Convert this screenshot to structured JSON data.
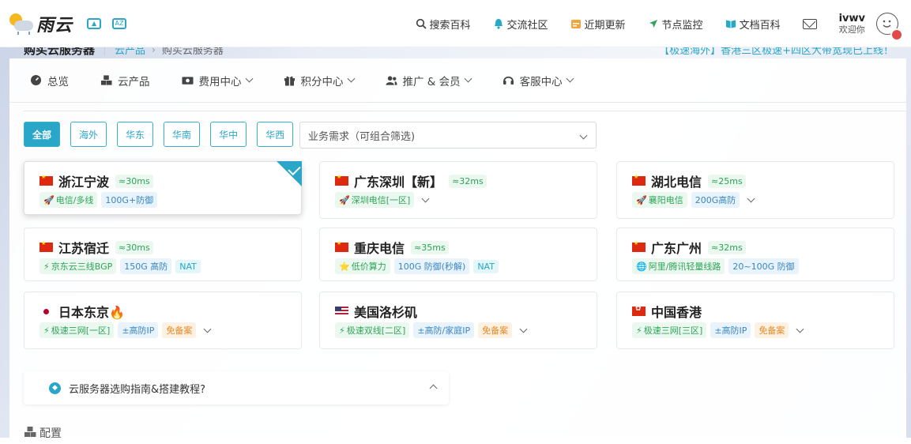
{
  "header": {
    "logo_text": "雨云",
    "nav": [
      {
        "label": "搜索百科",
        "icon": "search-icon"
      },
      {
        "label": "交流社区",
        "icon": "bell-icon"
      },
      {
        "label": "近期更新",
        "icon": "calendar-icon"
      },
      {
        "label": "节点监控",
        "icon": "send-icon"
      },
      {
        "label": "文档百科",
        "icon": "book-icon"
      }
    ],
    "user_name": "ivwv",
    "user_greeting": "欢迎你"
  },
  "titlebar": {
    "page_title": "购买云服务器",
    "crumb_parent": "云产品",
    "crumb_current": "购买云服务器",
    "notice": "【极速海外】香港三区极速+四区大带宽现已上线！"
  },
  "subnav": [
    {
      "label": "总览",
      "icon": "dashboard-icon",
      "has_dropdown": false
    },
    {
      "label": "云产品",
      "icon": "cubes-icon",
      "has_dropdown": false
    },
    {
      "label": "费用中心",
      "icon": "money-icon",
      "has_dropdown": true
    },
    {
      "label": "积分中心",
      "icon": "gift-icon",
      "has_dropdown": true
    },
    {
      "label": "推广 & 会员",
      "icon": "users-icon",
      "has_dropdown": true
    },
    {
      "label": "客服中心",
      "icon": "headset-icon",
      "has_dropdown": true
    }
  ],
  "filters": {
    "regions": [
      "全部",
      "海外",
      "华东",
      "华南",
      "华中",
      "华西"
    ],
    "active": "全部",
    "requirement_placeholder": "业务需求（可组合筛选)"
  },
  "regions": [
    {
      "name": "浙江宁波",
      "flag": "cn",
      "ping": "≈30ms",
      "selected": true,
      "tags": [
        {
          "text": "电信/多线",
          "style": "green",
          "icon": "rocket-icon"
        },
        {
          "text": "100G+防御",
          "style": "blue"
        }
      ]
    },
    {
      "name": "广东深圳【新】",
      "flag": "cn",
      "ping": "≈32ms",
      "selected": false,
      "expand": true,
      "tags": [
        {
          "text": "深圳电信[一区]",
          "style": "green",
          "icon": "rocket-icon"
        }
      ]
    },
    {
      "name": "湖北电信",
      "flag": "cn",
      "ping": "≈25ms",
      "selected": false,
      "expand": true,
      "tags": [
        {
          "text": "襄阳电信",
          "style": "green",
          "icon": "rocket-icon"
        },
        {
          "text": "200G高防",
          "style": "blue"
        }
      ]
    },
    {
      "name": "江苏宿迁",
      "flag": "cn",
      "ping": "≈30ms",
      "selected": false,
      "tags": [
        {
          "text": "京东云三线BGP",
          "style": "green",
          "icon": "bolt-icon"
        },
        {
          "text": "150G 高防",
          "style": "blue"
        },
        {
          "text": "NAT",
          "style": "cyan"
        }
      ]
    },
    {
      "name": "重庆电信",
      "flag": "cn",
      "ping": "≈35ms",
      "selected": false,
      "tags": [
        {
          "text": "低价算力",
          "style": "green",
          "icon": "star-icon"
        },
        {
          "text": "100G 防御(秒解)",
          "style": "blue"
        },
        {
          "text": "NAT",
          "style": "cyan"
        }
      ]
    },
    {
      "name": "广东广州",
      "flag": "cn",
      "ping": "≈32ms",
      "selected": false,
      "tags": [
        {
          "text": "阿里/腾讯轻量线路",
          "style": "green",
          "icon": "globe-icon"
        },
        {
          "text": "20~100G 防御",
          "style": "blue"
        }
      ]
    },
    {
      "name": "日本东京🔥",
      "flag": "jp",
      "ping": "",
      "selected": false,
      "expand": true,
      "tags": [
        {
          "text": "极速三网[一区]",
          "style": "green",
          "icon": "bolt-icon"
        },
        {
          "text": "±高防IP",
          "style": "blue"
        },
        {
          "text": "免备案",
          "style": "orange"
        }
      ]
    },
    {
      "name": "美国洛杉矶",
      "flag": "us",
      "ping": "",
      "selected": false,
      "expand": true,
      "tags": [
        {
          "text": "极速双线[二区]",
          "style": "green",
          "icon": "bolt-icon"
        },
        {
          "text": "±高防/家庭IP",
          "style": "blue"
        },
        {
          "text": "免备案",
          "style": "orange"
        }
      ]
    },
    {
      "name": "中国香港",
      "flag": "hk",
      "ping": "",
      "selected": false,
      "expand": true,
      "tags": [
        {
          "text": "极速三网[三区]",
          "style": "green",
          "icon": "bolt-icon"
        },
        {
          "text": "±高防IP",
          "style": "blue"
        },
        {
          "text": "免备案",
          "style": "orange"
        }
      ]
    }
  ],
  "guide": {
    "text": "云服务器选购指南&搭建教程?"
  },
  "config_section": {
    "label": "配置"
  },
  "colors": {
    "accent": "#2aa6c9",
    "ping_green": "#2fa35a"
  }
}
